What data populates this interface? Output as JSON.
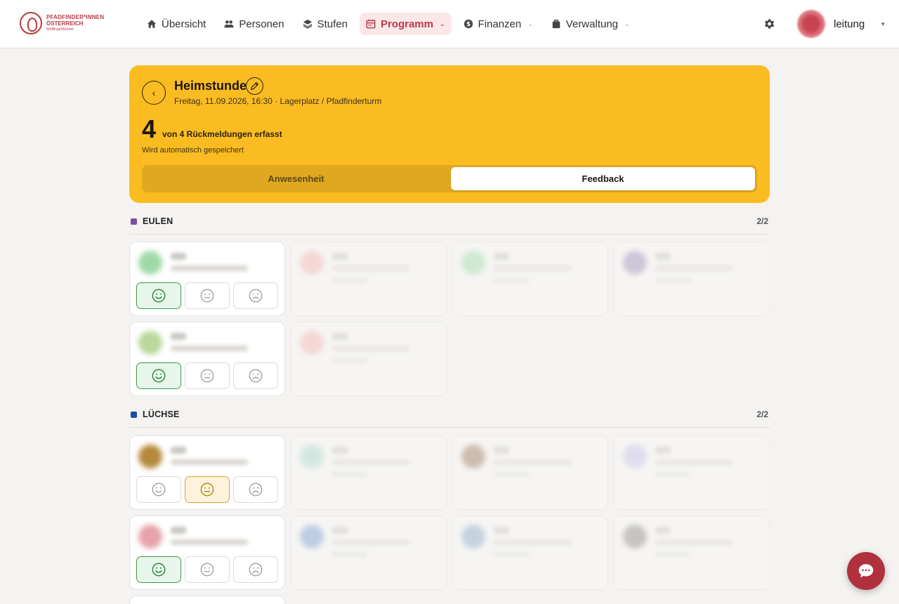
{
  "logo": {
    "line1": "PFADFINDER*INNEN",
    "line2": "ÖSTERREICH",
    "line3": "Wölflinge/Wichtel"
  },
  "nav": {
    "items": [
      {
        "label": "Übersicht",
        "icon": "home-icon"
      },
      {
        "label": "Personen",
        "icon": "people-icon"
      },
      {
        "label": "Stufen",
        "icon": "layers-icon"
      },
      {
        "label": "Programm",
        "icon": "calendar-icon",
        "active": true
      },
      {
        "label": "Finanzen",
        "icon": "dollar-icon"
      },
      {
        "label": "Verwaltung",
        "icon": "briefcase-icon"
      }
    ]
  },
  "user": {
    "name": "leitung"
  },
  "event": {
    "title": "Heimstunde",
    "meta": "Freitag, 11.09.2026, 16:30 · Lagerplatz / Pfadfinderturm",
    "count": "4",
    "count_text": "von 4 Rückmeldungen erfasst",
    "autosave": "Wird automatisch gespeichert",
    "tabs": {
      "attendance": "Anwesenheit",
      "feedback": "Feedback"
    }
  },
  "groups": [
    {
      "name": "EULEN",
      "count": "2/2",
      "color": "#7c4f9e"
    },
    {
      "name": "LÜCHSE",
      "count": "2/2",
      "color": "#1e4ea3"
    }
  ],
  "colors": {
    "accent": "#b73a46",
    "header": "#fbbc22",
    "good": "#3c9a4b",
    "ok": "#d7a634"
  }
}
